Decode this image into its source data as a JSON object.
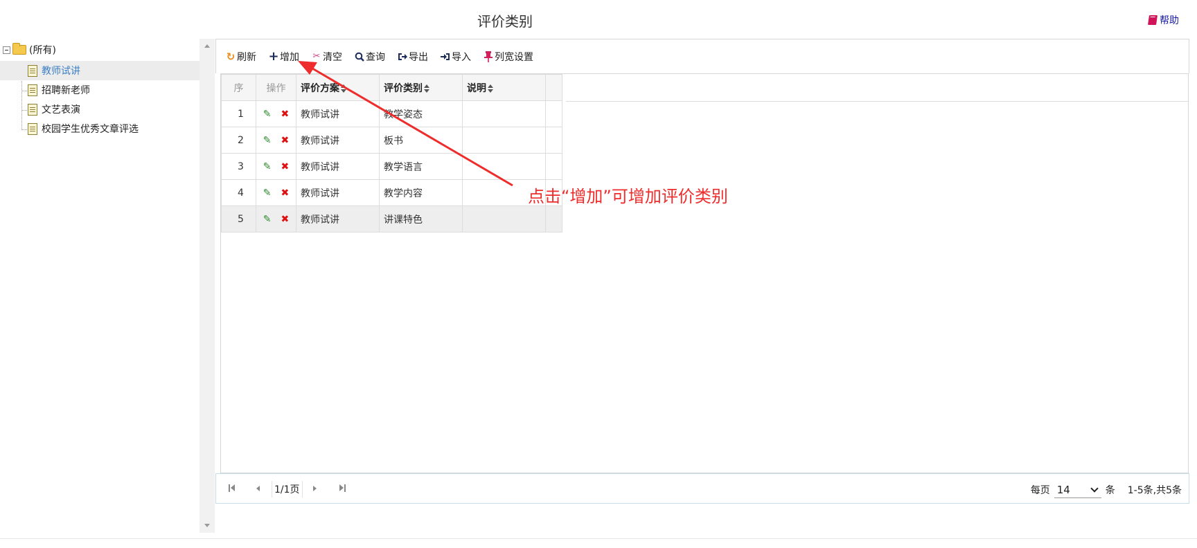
{
  "header": {
    "title": "评价类别",
    "help_label": "帮助"
  },
  "tree": {
    "root_label": "(所有)",
    "items": [
      {
        "label": "教师试讲",
        "selected": true
      },
      {
        "label": "招聘新老师",
        "selected": false
      },
      {
        "label": "文艺表演",
        "selected": false
      },
      {
        "label": "校园学生优秀文章评选",
        "selected": false
      }
    ]
  },
  "toolbar": {
    "refresh": "刷新",
    "add": "增加",
    "clear": "清空",
    "query": "查询",
    "export": "导出",
    "import": "导入",
    "column_width": "列宽设置"
  },
  "grid": {
    "columns": {
      "seq": "序",
      "op": "操作",
      "plan": "评价方案",
      "category": "评价类别",
      "note": "说明"
    },
    "rows": [
      {
        "seq": "1",
        "plan": "教师试讲",
        "category": "教学姿态",
        "note": ""
      },
      {
        "seq": "2",
        "plan": "教师试讲",
        "category": "板书",
        "note": ""
      },
      {
        "seq": "3",
        "plan": "教师试讲",
        "category": "教学语言",
        "note": ""
      },
      {
        "seq": "4",
        "plan": "教师试讲",
        "category": "教学内容",
        "note": ""
      },
      {
        "seq": "5",
        "plan": "教师试讲",
        "category": "讲课特色",
        "note": ""
      }
    ],
    "highlighted_row": 5
  },
  "pager": {
    "page_info": "1/1页",
    "per_page_label": "每页",
    "per_page_value": "14",
    "unit_label": "条",
    "total_label": "1-5条,共5条"
  },
  "annotation": {
    "text": "点击“增加”可增加评价类别",
    "color": "#ee2c2c"
  },
  "icons": {
    "refresh": "refresh-icon",
    "add": "plus-icon",
    "clear": "scissors-icon",
    "query": "search-icon",
    "export": "export-icon",
    "import": "import-icon",
    "column_width": "pin-icon",
    "help": "book-icon",
    "edit": "pencil-icon",
    "delete": "close-icon"
  }
}
